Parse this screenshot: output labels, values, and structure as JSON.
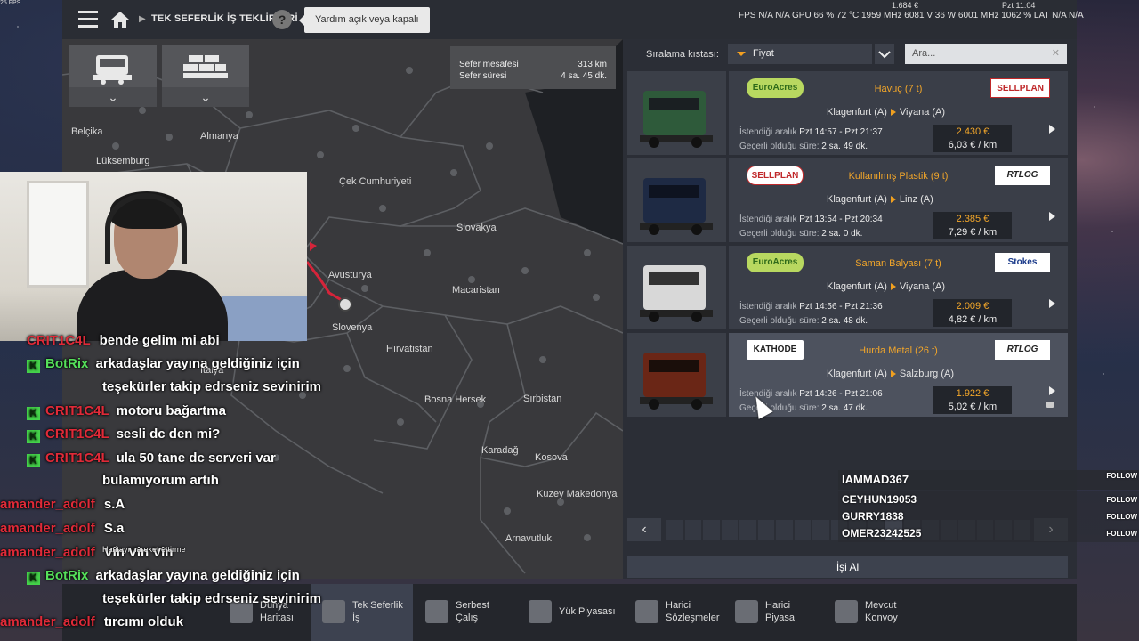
{
  "corner_fps": "25 FPS",
  "topbar": {
    "breadcrumb": "TEK SEFERLİK İŞ TEKLİFLERİ",
    "help": "?",
    "tooltip": "Yardım açık veya kapalı",
    "stats": "FPS N/A N/A   GPU 66 % 72 °C 1959 MHz 6081 V 36 W 6001 MHz   1062 %   LAT N/A N/A",
    "money": "1.684 €",
    "time": "Pzt 11:04"
  },
  "map": {
    "distance_label": "Sefer mesafesi",
    "distance_value": "313 km",
    "duration_label": "Sefer süresi",
    "duration_value": "4 sa. 45 dk.",
    "labels": [
      "Belçika",
      "Almanya",
      "Lüksemburg",
      "Çek Cumhuriyeti",
      "Slovakya",
      "Avusturya",
      "Macaristan",
      "Slovenya",
      "Hırvatistan",
      "Bosna Hersek",
      "Sırbistan",
      "Karadağ",
      "Kosova",
      "Kuzey Makedonya",
      "Arnavutluk",
      "İtalya"
    ]
  },
  "sort": {
    "label": "Sıralama kıstası:",
    "value": "Fiyat",
    "search_placeholder": "Ara..."
  },
  "jobs": [
    {
      "cargo": "Havuç (7 t)",
      "from": "Klagenfurt (A)",
      "to": "Viyana (A)",
      "window_label": "İstendiği aralık",
      "window": "Pzt 14:57 - Pzt 21:37",
      "valid_label": "Geçerli olduğu süre:",
      "valid": "2 sa. 49 dk.",
      "price": "2.430 €",
      "per_km": "6,03 € / km",
      "left_logo": "EuroAcres",
      "right_logo": "SELLPLAN",
      "truck_color": "#2e5a3a"
    },
    {
      "cargo": "Kullanılmış Plastik (9 t)",
      "from": "Klagenfurt (A)",
      "to": "Linz (A)",
      "window_label": "İstendiği aralık",
      "window": "Pzt 13:54 - Pzt 20:34",
      "valid_label": "Geçerli olduğu süre:",
      "valid": "2 sa. 0 dk.",
      "price": "2.385 €",
      "per_km": "7,29 € / km",
      "left_logo": "SELLPLAN",
      "right_logo": "RTLOG",
      "truck_color": "#1e2a44"
    },
    {
      "cargo": "Saman Balyası (7 t)",
      "from": "Klagenfurt (A)",
      "to": "Viyana (A)",
      "window_label": "İstendiği aralık",
      "window": "Pzt 14:56 - Pzt 21:36",
      "valid_label": "Geçerli olduğu süre:",
      "valid": "2 sa. 48 dk.",
      "price": "2.009 €",
      "per_km": "4,82 € / km",
      "left_logo": "EuroAcres",
      "right_logo": "Stokes",
      "truck_color": "#d8d8d8"
    },
    {
      "cargo": "Hurda Metal (26 t)",
      "from": "Klagenfurt (A)",
      "to": "Salzburg (A)",
      "window_label": "İstendiği aralık",
      "window": "Pzt 14:26 - Pzt 21:06",
      "valid_label": "Geçerli olduğu süre:",
      "valid": "2 sa. 47 dk.",
      "price": "1.922 €",
      "per_km": "5,02 € / km",
      "left_logo": "KATHODE",
      "right_logo": "RTLOG",
      "truck_color": "#6a2616"
    }
  ],
  "take_job": "İşi Al",
  "bottom_nav": [
    {
      "label": "Dünya\nHaritası"
    },
    {
      "label": "Tek Seferlik\nİş"
    },
    {
      "label": "Serbest\nÇalış"
    },
    {
      "label": "Yük Piyasası"
    },
    {
      "label": "Harici\nSözleşmeler"
    },
    {
      "label": "Harici\nPiyasa"
    },
    {
      "label": "Mevcut\nKonvoy"
    }
  ],
  "chat": [
    {
      "user": "CRIT1C4L",
      "text": "bende gelim mi abi",
      "badge": false
    },
    {
      "user": "BotRix",
      "text": "arkadaşlar yayına geldiğiniz için",
      "badge": true,
      "bot": true
    },
    {
      "user": "",
      "text": "teşekürler takip edrseniz sevinirim",
      "badge": false
    },
    {
      "user": "CRIT1C4L",
      "text": "motoru bağartma",
      "badge": true
    },
    {
      "user": "CRIT1C4L",
      "text": "sesli dc den mi?",
      "badge": true
    },
    {
      "user": "CRIT1C4L",
      "text": "ula 50 tane dc serveri var",
      "badge": true
    },
    {
      "user": "",
      "text": "bulamıyorum artıh",
      "badge": false
    },
    {
      "user": "amander_adolf",
      "text": "s.A",
      "badge": false
    },
    {
      "user": "amander_adolf",
      "text": "S.a",
      "badge": false
    },
    {
      "user": "amander_adolf",
      "text": "Vin Vin Vin",
      "badge": false
    },
    {
      "user": "BotRix",
      "text": "arkadaşlar yayına geldiğiniz için",
      "badge": true,
      "bot": true
    },
    {
      "user": "",
      "text": "teşekürler takip edrseniz sevinirim",
      "badge": false
    },
    {
      "user": "amander_adolf",
      "text": "tırcımı olduk",
      "badge": false
    }
  ],
  "chat_system_note": "Haritayı hareket ettirme",
  "follows": {
    "tag": "FOLLOW",
    "names": [
      "IAMMAD367",
      "CEYHUN19053",
      "GURRY1838",
      "OMER23242525"
    ]
  }
}
